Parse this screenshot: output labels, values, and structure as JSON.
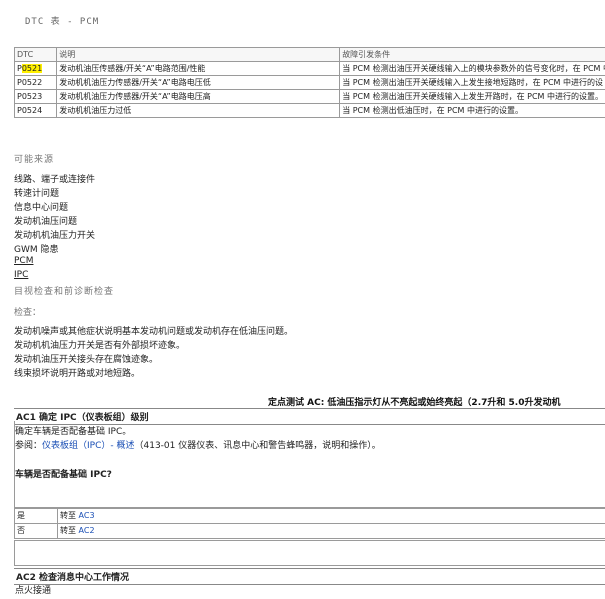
{
  "doc_title": "DTC 表 - PCM",
  "dtc_table": {
    "headers": [
      "DTC",
      "说明",
      "故障引发条件"
    ],
    "rows": [
      {
        "code_prefix": "P",
        "code_hl": "0521",
        "desc": "发动机油压传感器/开关“A”电路范围/性能",
        "cond": "当 PCM 检测出油压开关硬线输入上的模块参数外的信号变化时，在 PCM 中"
      },
      {
        "code": "P0522",
        "desc": "发动机机油压力传感器/开关“A”电路电压低",
        "cond": "当 PCM 检测出油压开关硬线输入上发生接地短路时，在 PCM 中进行的设"
      },
      {
        "code": "P0523",
        "desc": "发动机机油压力传感器/开关“A”电路电压高",
        "cond": "当 PCM 检测出油压开关硬线输入上发生开路时，在 PCM 中进行的设置。"
      },
      {
        "code": "P0524",
        "desc": "发动机机油压力过低",
        "cond": "当 PCM 检测出低油压时，在 PCM 中进行的设置。"
      }
    ]
  },
  "possible_sources": {
    "heading": "可能来源",
    "items": [
      "线路、端子或连接件",
      "转速计问题",
      "信息中心问题",
      "发动机油压问题",
      "发动机机油压力开关",
      "GWM 隐患",
      "PCM",
      "IPC"
    ],
    "visual_check": "目视检查和前诊断检查"
  },
  "check": {
    "heading": "检查：",
    "items": [
      "发动机噪声或其他症状说明基本发动机问题或发动机存在低油压问题。",
      "发动机机油压力开关是否有外部损坏迹象。",
      "发动机油压开关接头存在腐蚀迹象。",
      "线束损坏说明开路或对地短路。"
    ]
  },
  "pinpoint_title": "定点测试 AC: 低油压指示灯从不亮起或始终亮起（2.7升和 5.0升发动机",
  "ac1": {
    "header": "AC1 确定 IPC（仪表板组）级别",
    "line1": "确定车辆是否配备基础 IPC。",
    "ref_prefix": "参阅：",
    "ref_link": "仪表板组（IPC）- 概述",
    "ref_suffix": "（413-01 仪器仪表、讯息中心和警告蜂鸣器，说明和操作）。",
    "question": "车辆是否配备基础 IPC?",
    "answers": [
      {
        "label": "是",
        "action_prefix": "转至 ",
        "action_link": "AC3"
      },
      {
        "label": "否",
        "action_prefix": "转至 ",
        "action_link": "AC2"
      }
    ]
  },
  "ac2": {
    "header": "AC2 检查消息中心工作情况",
    "line1": "点火接通"
  }
}
